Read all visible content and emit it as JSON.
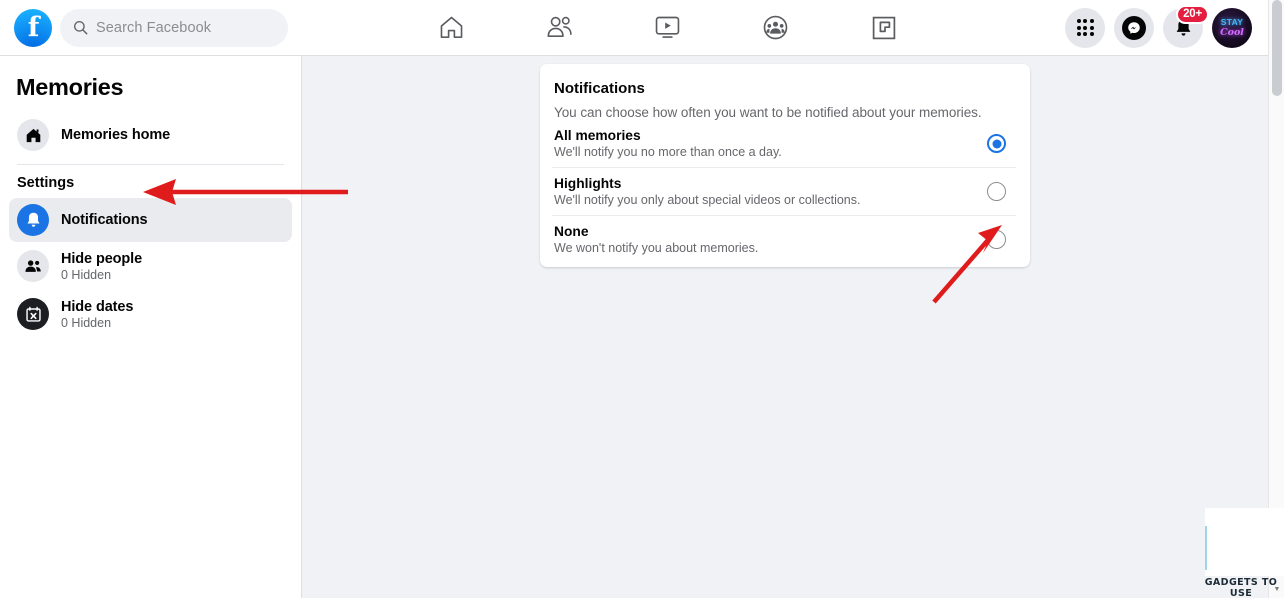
{
  "topbar": {
    "logo_icon": "facebook-logo",
    "logo_letter": "f",
    "search": {
      "icon": "search-icon",
      "placeholder": "Search Facebook",
      "value": ""
    },
    "nav": [
      {
        "name": "home",
        "icon": "home-icon",
        "label": "Home"
      },
      {
        "name": "friends",
        "icon": "friends-icon",
        "label": "Friends"
      },
      {
        "name": "watch",
        "icon": "video-play-icon",
        "label": "Watch"
      },
      {
        "name": "groups",
        "icon": "groups-icon",
        "label": "Groups"
      },
      {
        "name": "gaming",
        "icon": "gaming-icon",
        "label": "Gaming"
      }
    ],
    "right": {
      "menu_icon": "grid-menu-icon",
      "messenger_icon": "messenger-icon",
      "notifications_icon": "bell-icon",
      "notifications_badge": "20+",
      "avatar_icon": "profile-avatar",
      "avatar_line1": "STAY",
      "avatar_line2": "Cool"
    }
  },
  "sidebar": {
    "title": "Memories",
    "home_item": {
      "label": "Memories home",
      "icon": "home-filled-icon"
    },
    "settings_header": "Settings",
    "items": [
      {
        "label": "Notifications",
        "icon": "bell-icon",
        "sub": "",
        "active": true
      },
      {
        "label": "Hide people",
        "icon": "people-icon",
        "sub": "0 Hidden",
        "active": false
      },
      {
        "label": "Hide dates",
        "icon": "calendar-x-icon",
        "sub": "0 Hidden",
        "active": false
      }
    ]
  },
  "panel": {
    "title": "Notifications",
    "description": "You can choose how often you want to be notified about your memories.",
    "options": [
      {
        "title": "All memories",
        "subtitle": "We'll notify you no more than once a day.",
        "selected": true
      },
      {
        "title": "Highlights",
        "subtitle": "We'll notify you only about special videos or collections.",
        "selected": false
      },
      {
        "title": "None",
        "subtitle": "We won't notify you about memories.",
        "selected": false
      }
    ]
  },
  "annotations": {
    "arrow_color": "#e01b1b",
    "arrow_1_target": "sidebar-item-notifications",
    "arrow_2_target": "radio-option-none"
  },
  "watermark": {
    "text": "GADGETS TO USE"
  },
  "colors": {
    "accent_blue": "#1b74e4",
    "page_bg": "#f0f2f5",
    "card_bg": "#ffffff",
    "badge_red": "#e41e3f"
  }
}
